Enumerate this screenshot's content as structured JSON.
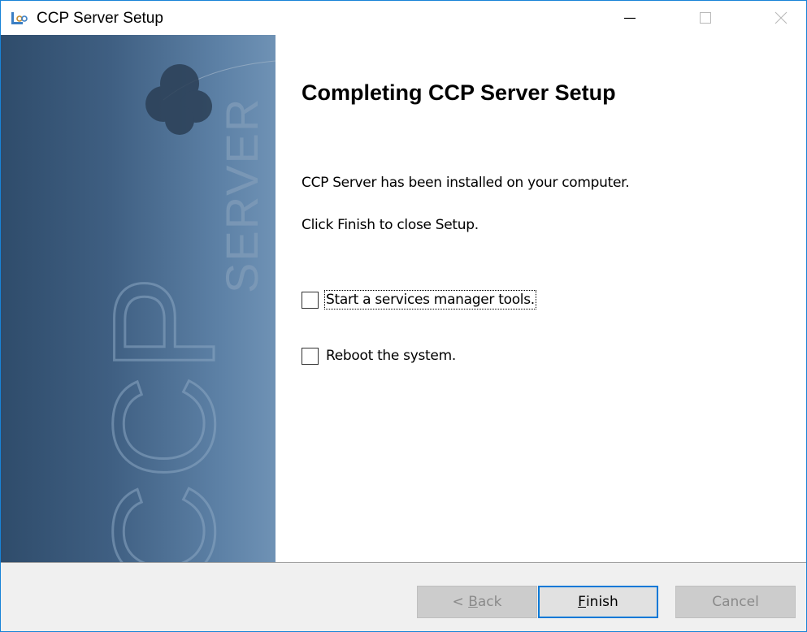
{
  "window": {
    "title": "CCP Server Setup",
    "accent_color": "#1883d7"
  },
  "titlebar": {
    "icon": "installer-app-icon",
    "buttons": [
      "minimize",
      "maximize",
      "close"
    ]
  },
  "banner": {
    "brand_large": "CCP",
    "brand_small": "SERVER",
    "logo_icon": "cloud-logo-icon"
  },
  "content": {
    "heading": "Completing CCP Server Setup",
    "line1": "CCP Server has been installed on your computer.",
    "line2": "Click Finish to close Setup."
  },
  "options": [
    {
      "label": "Start a services manager tools.",
      "checked": false,
      "focused": true
    },
    {
      "label": "Reboot the system.",
      "checked": false,
      "focused": false
    }
  ],
  "footer": {
    "back": {
      "prefix": "< ",
      "accel": "B",
      "rest": "ack",
      "enabled": false
    },
    "finish": {
      "accel": "F",
      "rest": "inish",
      "enabled": true,
      "default": true
    },
    "cancel": {
      "label": "Cancel",
      "enabled": false
    }
  }
}
